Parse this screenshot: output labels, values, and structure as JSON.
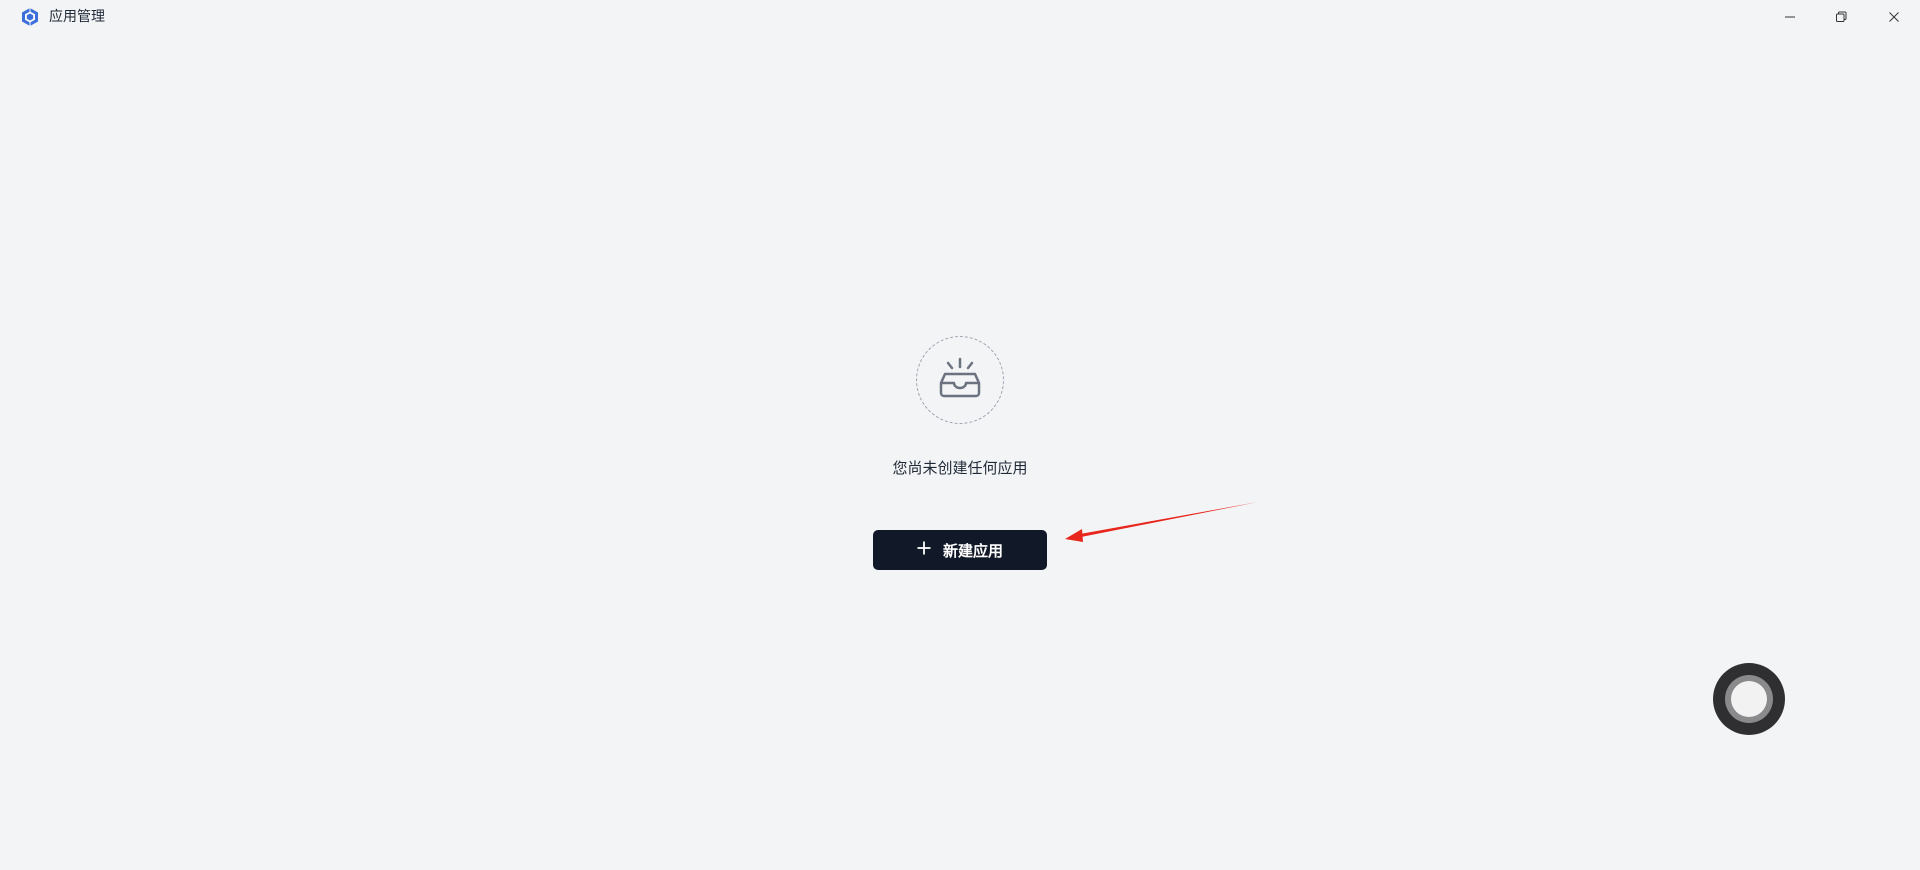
{
  "window": {
    "title": "应用管理",
    "logo_icon": "hexagon-logo-icon",
    "controls": [
      "minimize-icon",
      "restore-icon",
      "close-icon"
    ]
  },
  "empty_state": {
    "icon": "inbox-tray-icon",
    "message": "您尚未创建任何应用"
  },
  "actions": {
    "create_app_label": "新建应用",
    "create_app_icon": "plus-icon"
  },
  "annotation": {
    "arrow_color": "#e8261c"
  },
  "floating_button": {
    "icon": "assistive-touch-icon"
  },
  "colors": {
    "background": "#f3f4f6",
    "button_bg": "#111827",
    "button_text": "#ffffff",
    "logo_blue": "#3b6fd9"
  }
}
